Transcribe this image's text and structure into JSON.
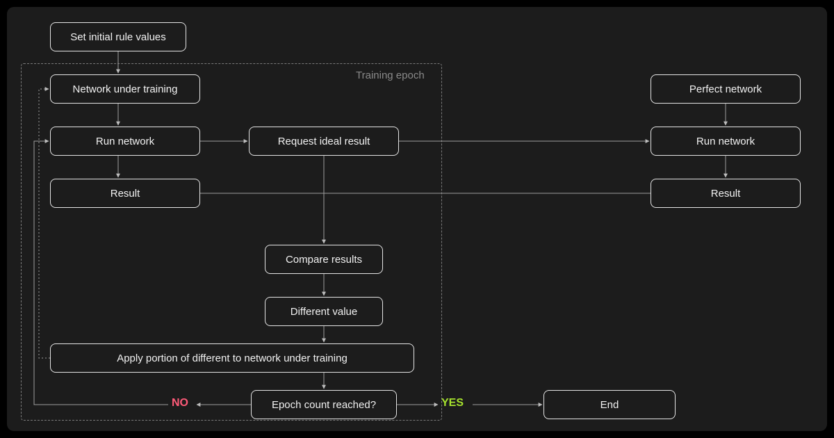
{
  "nodes": {
    "set_initial": "Set initial rule values",
    "network_under_training": "Network under training",
    "run_network_left": "Run network",
    "result_left": "Result",
    "request_ideal": "Request ideal result",
    "compare_results": "Compare results",
    "different_value": "Different value",
    "apply_portion": "Apply portion of different to network under training",
    "epoch_reached": "Epoch count reached?",
    "perfect_network": "Perfect network",
    "run_network_right": "Run network",
    "result_right": "Result",
    "end": "End"
  },
  "group": {
    "training_epoch": "Training epoch"
  },
  "labels": {
    "no": "NO",
    "yes": "YES"
  }
}
